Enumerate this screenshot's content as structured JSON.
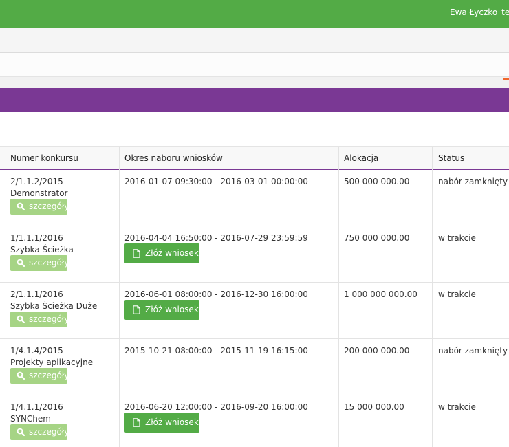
{
  "topbar": {
    "user_name": "Ewa Łyczko_test"
  },
  "table": {
    "headers": {
      "number": "Numer konkursu",
      "period": "Okres naboru wniosków",
      "allocation": "Alokacja",
      "status": "Status"
    },
    "rows": [
      {
        "number": "2/1.1.2/2015",
        "name": "Demonstrator",
        "period": "2016-01-07 09:30:00 - 2016-03-01 00:00:00",
        "allocation": "500 000 000.00",
        "status": "nabór zamknięty",
        "action": "details"
      },
      {
        "number": "1/1.1.1/2016",
        "name": "Szybka Ścieżka",
        "period": "2016-04-04 16:50:00 - 2016-07-29 23:59:59",
        "allocation": "750 000 000.00",
        "status": "w trakcie",
        "action": "apply"
      },
      {
        "number": "2/1.1.1/2016",
        "name": "Szybka Ścieżka Duże",
        "period": "2016-06-01 08:00:00 - 2016-12-30 16:00:00",
        "allocation": "1 000 000 000.00",
        "status": "w trakcie",
        "action": "apply"
      },
      {
        "number": "1/4.1.4/2015",
        "name": "Projekty aplikacyjne",
        "period": "2015-10-21 08:00:00 - 2015-11-19 16:15:00",
        "allocation": "200 000 000.00",
        "status": "nabór zamknięty",
        "action": "details"
      },
      {
        "number": "1/4.1.1/2016",
        "name": "SYNChem",
        "period": "2016-06-20 12:00:00 - 2016-09-20 16:00:00",
        "allocation": "15 000 000.00",
        "status": "w trakcie",
        "action": "apply"
      }
    ]
  },
  "buttons": {
    "details_label": "szczegóły",
    "apply_label": "Złóż wniosek"
  },
  "icons": {
    "details": "search-icon",
    "apply": "document-icon"
  },
  "colors": {
    "green": "#53ab46",
    "light_green": "#a6d485",
    "purple": "#7a3894",
    "orange": "#f0652b"
  }
}
